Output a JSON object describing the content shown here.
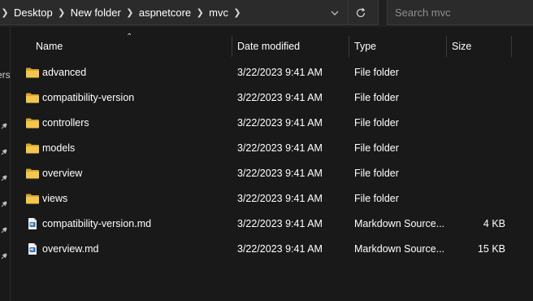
{
  "breadcrumb": {
    "items": [
      "Desktop",
      "New folder",
      "aspnetcore",
      "mvc"
    ]
  },
  "search": {
    "placeholder": "Search mvc"
  },
  "navpane": {
    "fragment": "ers"
  },
  "columns": {
    "name": "Name",
    "date": "Date modified",
    "type": "Type",
    "size": "Size"
  },
  "files": [
    {
      "name": "advanced",
      "date": "3/22/2023 9:41 AM",
      "type": "File folder",
      "size": "",
      "icon": "folder-icon"
    },
    {
      "name": "compatibility-version",
      "date": "3/22/2023 9:41 AM",
      "type": "File folder",
      "size": "",
      "icon": "folder-icon"
    },
    {
      "name": "controllers",
      "date": "3/22/2023 9:41 AM",
      "type": "File folder",
      "size": "",
      "icon": "folder-icon"
    },
    {
      "name": "models",
      "date": "3/22/2023 9:41 AM",
      "type": "File folder",
      "size": "",
      "icon": "folder-icon"
    },
    {
      "name": "overview",
      "date": "3/22/2023 9:41 AM",
      "type": "File folder",
      "size": "",
      "icon": "folder-icon"
    },
    {
      "name": "views",
      "date": "3/22/2023 9:41 AM",
      "type": "File folder",
      "size": "",
      "icon": "folder-icon"
    },
    {
      "name": "compatibility-version.md",
      "date": "3/22/2023 9:41 AM",
      "type": "Markdown Source...",
      "size": "4 KB",
      "icon": "markdown-file-icon"
    },
    {
      "name": "overview.md",
      "date": "3/22/2023 9:41 AM",
      "type": "Markdown Source...",
      "size": "15 KB",
      "icon": "markdown-file-icon"
    }
  ],
  "colors": {
    "background": "#191919",
    "folder": "#f0c24a",
    "text": "#ffffff"
  }
}
